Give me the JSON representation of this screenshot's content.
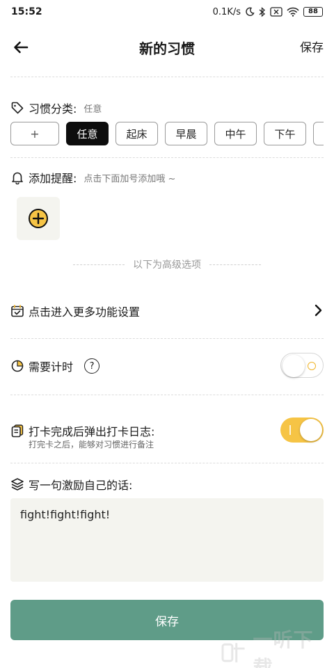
{
  "status": {
    "time": "15:52",
    "speed": "0.1K/s",
    "battery": "88"
  },
  "nav": {
    "title": "新的习惯",
    "save": "保存"
  },
  "category": {
    "label": "习惯分类:",
    "current": "任意",
    "add": "+",
    "tags": [
      "任意",
      "起床",
      "早晨",
      "中午",
      "下午"
    ]
  },
  "reminder": {
    "label": "添加提醒:",
    "hint": "点击下面加号添加哦 ~"
  },
  "advanced": {
    "text": "以下为高级选项"
  },
  "more_settings": {
    "label": "点击进入更多功能设置"
  },
  "timer": {
    "label": "需要计时",
    "help": "?",
    "enabled": false
  },
  "log": {
    "label": "打卡完成后弹出打卡日志:",
    "note": "打完卡之后，能够对习惯进行备注",
    "enabled": true
  },
  "motto": {
    "label": "写一句激励自己的话:",
    "value": "fight!fight!fight!"
  },
  "footer": {
    "save": "保存"
  },
  "watermark": {
    "text": "一听下载"
  },
  "colors": {
    "accent_yellow": "#f6c445",
    "save_green": "#5f9c88",
    "active_tag": "#0d0d0d"
  }
}
